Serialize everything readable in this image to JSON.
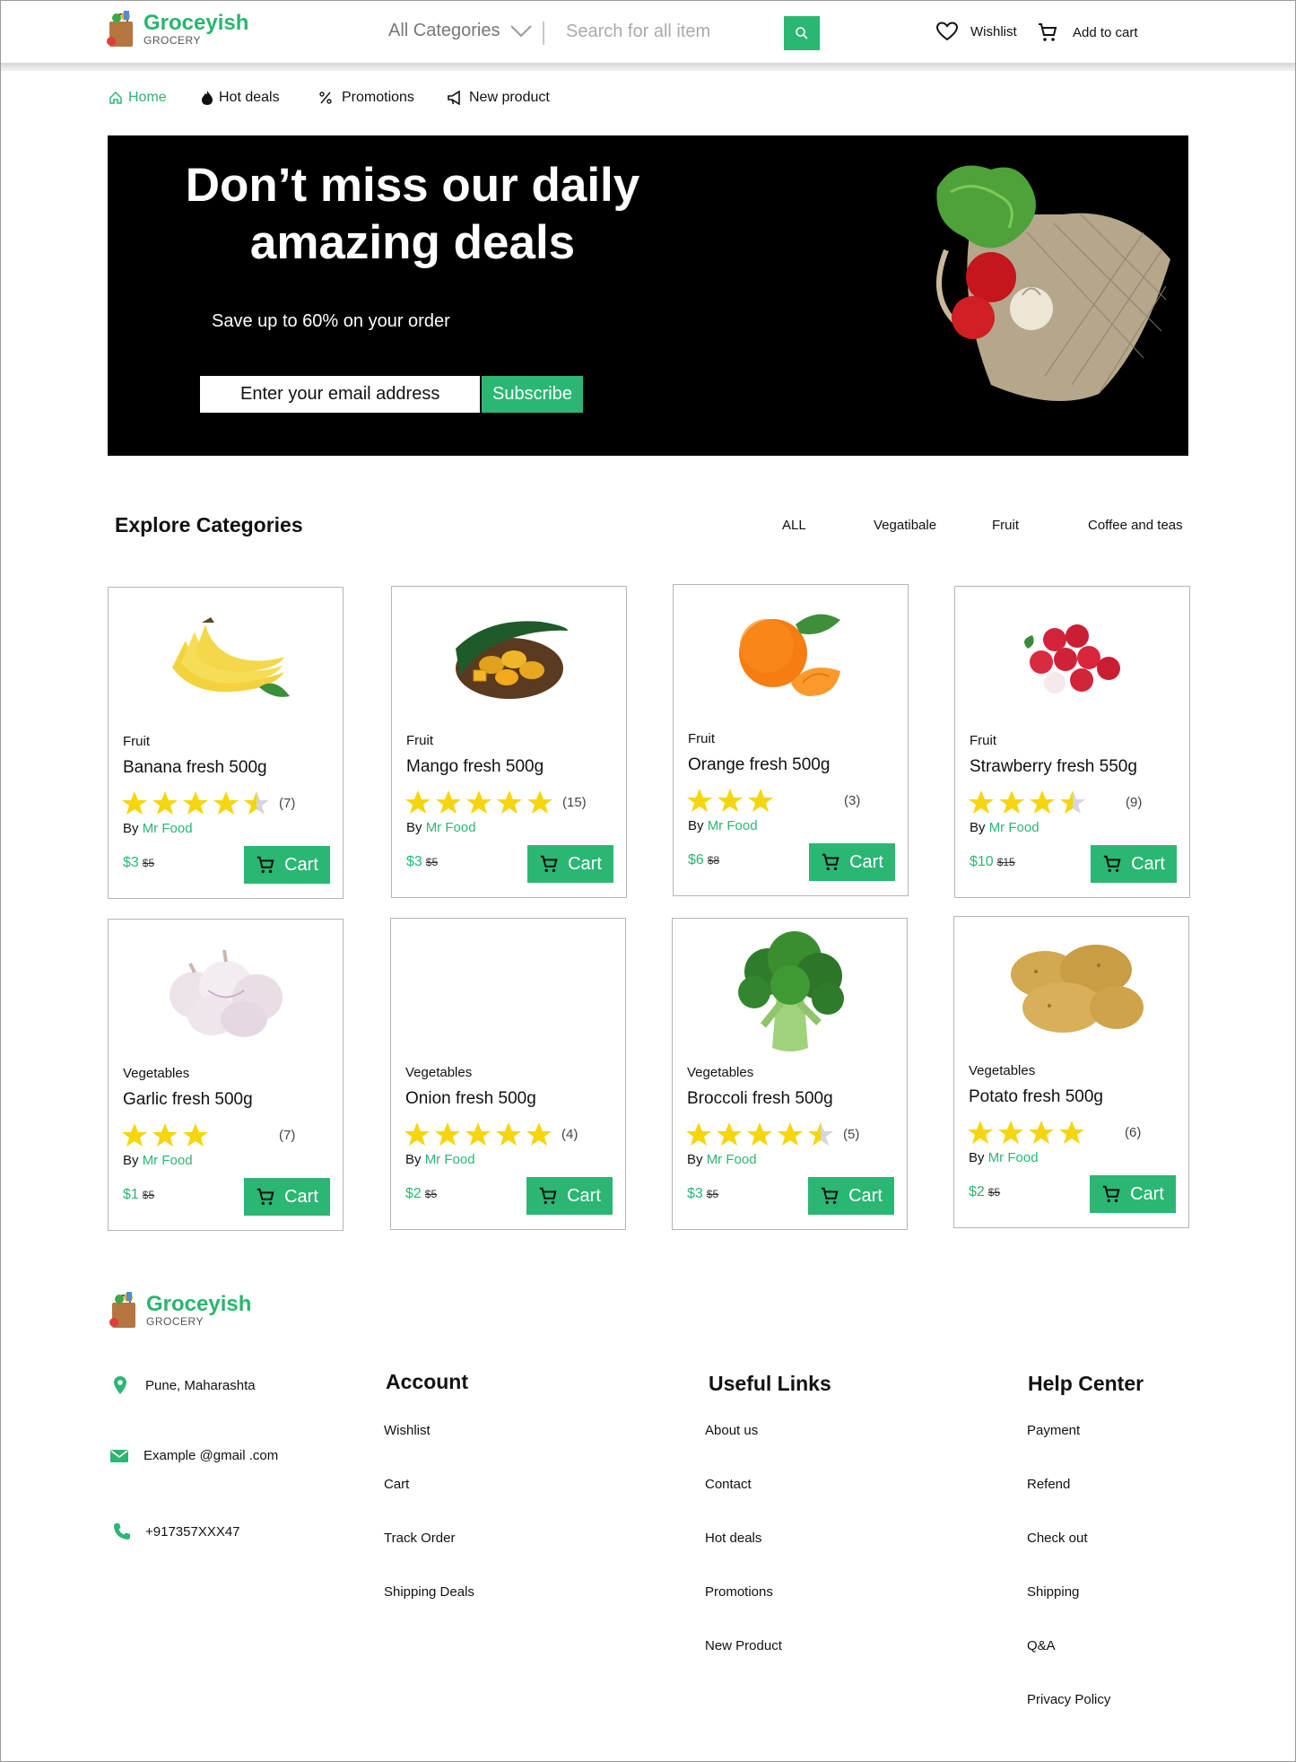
{
  "brand": {
    "name": "Groceyish",
    "tagline": "GROCERY",
    "accent": "#2bb673"
  },
  "header": {
    "category_select": "All Categories",
    "search_placeholder": "Search for all item",
    "wishlist": "Wishlist",
    "add_to_cart": "Add to cart"
  },
  "nav": [
    {
      "label": "Home",
      "icon": "home-icon",
      "active": true
    },
    {
      "label": "Hot deals",
      "icon": "flame-icon"
    },
    {
      "label": "Promotions",
      "icon": "percent-icon"
    },
    {
      "label": "New product",
      "icon": "megaphone-icon"
    }
  ],
  "hero": {
    "title": "Don’t miss our daily amazing deals",
    "subtitle": "Save up to 60% on your order",
    "email_placeholder": "Enter your email address",
    "subscribe": "Subscribe"
  },
  "categories": {
    "title": "Explore Categories",
    "filters": [
      "ALL",
      "Vegatibale",
      "Fruit",
      "Coffee and teas"
    ]
  },
  "products": [
    {
      "category": "Fruit",
      "name": "Banana fresh 500g",
      "rating": 4.5,
      "reviews": "(7)",
      "by": "By",
      "vendor": "Mr Food",
      "price": "$3",
      "old_price": "$5",
      "cart": "Cart",
      "image": "banana"
    },
    {
      "category": "Fruit",
      "name": "Mango fresh 500g",
      "rating": 5,
      "reviews": "(15)",
      "by": "By",
      "vendor": "Mr Food",
      "price": "$3",
      "old_price": "$5",
      "cart": "Cart",
      "image": "mango"
    },
    {
      "category": "Fruit",
      "name": "Orange fresh 500g",
      "rating": 3,
      "reviews": "(3)",
      "by": "By",
      "vendor": "Mr Food",
      "price": "$6",
      "old_price": "$8",
      "cart": "Cart",
      "image": "orange"
    },
    {
      "category": "Fruit",
      "name": "Strawberry fresh 550g",
      "rating": 3.5,
      "reviews": "(9)",
      "by": "By",
      "vendor": "Mr Food",
      "price": "$10",
      "old_price": "$15",
      "cart": "Cart",
      "image": "lychee"
    },
    {
      "category": "Vegetables",
      "name": "Garlic fresh 500g",
      "rating": 3,
      "reviews": "(7)",
      "by": "By",
      "vendor": "Mr Food",
      "price": "$1",
      "old_price": "$5",
      "cart": "Cart",
      "image": "garlic"
    },
    {
      "category": "Vegetables",
      "name": "Onion fresh 500g",
      "rating": 5,
      "reviews": "(4)",
      "by": "By",
      "vendor": "Mr Food",
      "price": "$2",
      "old_price": "$5",
      "cart": "Cart",
      "image": "none"
    },
    {
      "category": "Vegetables",
      "name": "Broccoli fresh 500g",
      "rating": 4.5,
      "reviews": "(5)",
      "by": "By",
      "vendor": "Mr Food",
      "price": "$3",
      "old_price": "$5",
      "cart": "Cart",
      "image": "broccoli"
    },
    {
      "category": "Vegetables",
      "name": "Potato fresh 500g",
      "rating": 4,
      "reviews": "(6)",
      "by": "By",
      "vendor": "Mr Food",
      "price": "$2",
      "old_price": "$5",
      "cart": "Cart",
      "image": "potato"
    }
  ],
  "footer": {
    "contact": {
      "location": "Pune, Maharashta",
      "email": "Example @gmail .com",
      "phone": "+917357XXX47"
    },
    "account": {
      "title": "Account",
      "links": [
        "Wishlist",
        "Cart",
        "Track Order",
        "Shipping Deals"
      ]
    },
    "useful": {
      "title": "Useful Links",
      "links": [
        "About us",
        "Contact",
        "Hot deals",
        "Promotions",
        "New Product"
      ]
    },
    "help": {
      "title": "Help Center",
      "links": [
        "Payment",
        "Refend",
        "Check out",
        "Shipping",
        "Q&A",
        "Privacy Policy"
      ]
    }
  }
}
